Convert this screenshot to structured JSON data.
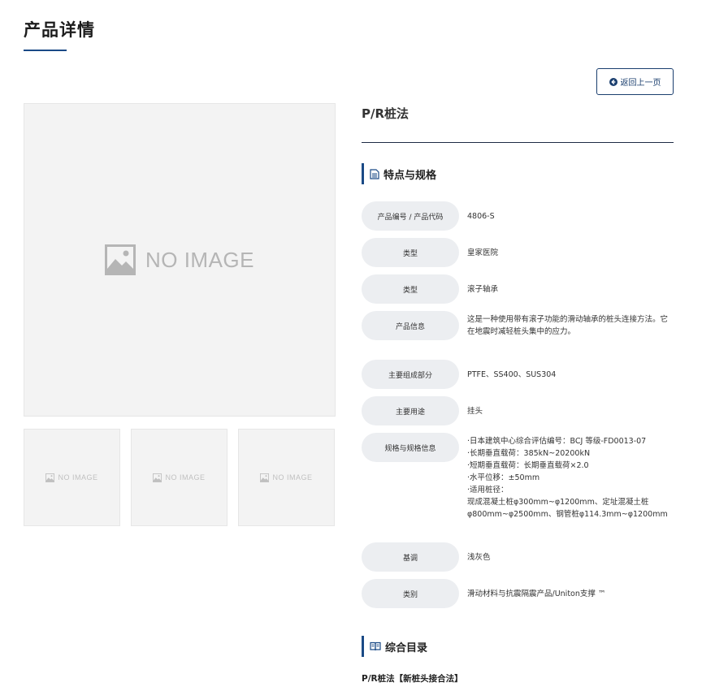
{
  "header": {
    "title": "产品详情"
  },
  "back_button": {
    "label": "返回上一页"
  },
  "gallery": {
    "main_placeholder": "NO IMAGE",
    "thumb_placeholder": "NO IMAGE"
  },
  "product": {
    "name": "P/R桩法"
  },
  "specs": {
    "heading": "特点与规格",
    "rows": [
      {
        "label": "产品编号 / 产品代码",
        "value": "4806-S"
      },
      {
        "label": "类型",
        "value": "皇家医院"
      },
      {
        "label": "类型",
        "value": "滚子轴承"
      },
      {
        "label": "产品信息",
        "value": "这是一种使用带有滚子功能的滑动轴承的桩头连接方法。它在地震时减轻桩头集中的应力。"
      },
      {
        "label": "主要组成部分",
        "value": "PTFE、SS400、SUS304"
      },
      {
        "label": "主要用途",
        "value": "挂头"
      },
      {
        "label": "规格与规格信息",
        "value": "·日本建筑中心综合评估编号：BCJ 等级-FD0013-07\n·长期垂直载荷：385kN~20200kN\n·短期垂直载荷：长期垂直载荷×2.0\n·水平位移：±50mm\n·适用桩径：\n现成混凝土桩φ300mm~φ1200mm、定址混凝土桩φ800mm~φ2500mm、钢管桩φ114.3mm~φ1200mm"
      },
      {
        "label": "基调",
        "value": "浅灰色"
      },
      {
        "label": "类别",
        "value": "滑动材料与抗震隔震产品/Uniton支撑 ™"
      }
    ]
  },
  "catalog": {
    "heading": "综合目录",
    "link": "P/R桩法【新桩头接合法】"
  },
  "colors": {
    "accent": "#1a4a86",
    "label_bg": "#eceef1",
    "placeholder_bg": "#f3f3f3"
  },
  "icons": {
    "back": "arrow-left-circle-icon",
    "spec": "document-icon",
    "catalog": "book-icon",
    "placeholder": "image-icon"
  }
}
